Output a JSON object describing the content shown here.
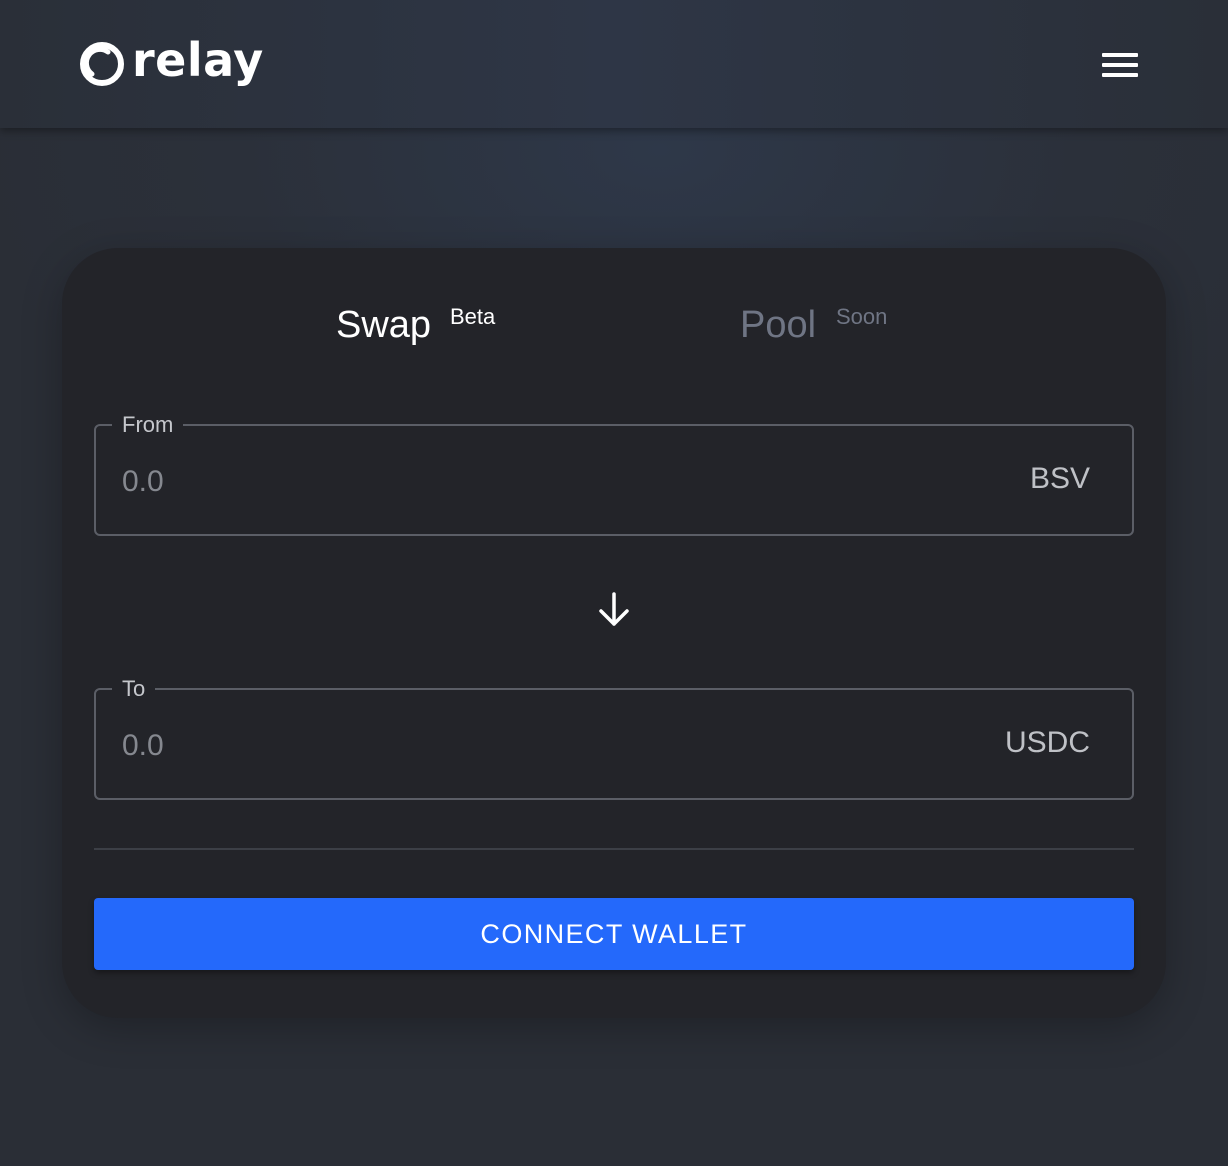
{
  "brand": {
    "name": "relay"
  },
  "header": {
    "menu_icon": "hamburger-menu-icon"
  },
  "tabs": [
    {
      "label": "Swap",
      "badge": "Beta",
      "active": true
    },
    {
      "label": "Pool",
      "badge": "Soon",
      "active": false
    }
  ],
  "from": {
    "legend": "From",
    "placeholder": "0.0",
    "value": "",
    "unit": "BSV"
  },
  "swap_icon": "arrow-down-icon",
  "to": {
    "legend": "To",
    "placeholder": "0.0",
    "value": "",
    "unit": "USDC"
  },
  "connect_button": {
    "label": "CONNECT WALLET"
  },
  "colors": {
    "background": "#2b2f38",
    "card": "#232429",
    "accent": "#2469fb",
    "inactive_tab": "#6f7584"
  }
}
